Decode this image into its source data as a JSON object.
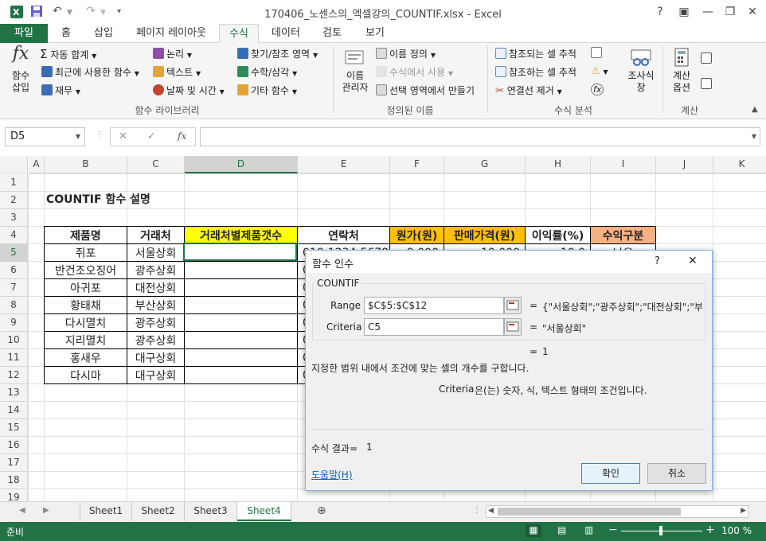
{
  "window": {
    "title": "170406_노센스의_엑셀강의_COUNTIF.xlsx - Excel",
    "help": "?"
  },
  "ribbon_tabs": [
    "파일",
    "홈",
    "삽입",
    "페이지 레이아웃",
    "수식",
    "데이터",
    "검토",
    "보기"
  ],
  "ribbon": {
    "function_library": {
      "insert_function": [
        "함수",
        "삽입"
      ],
      "autosum": "자동 합계",
      "recent": "최근에 사용한 함수",
      "financial": "재무",
      "logical": "논리",
      "text": "텍스트",
      "datetime": "날짜 및 시간",
      "lookup": "찾기/참조 영역",
      "math": "수학/삼각",
      "more": "기타 함수",
      "group_label": "함수 라이브러리"
    },
    "defined_names": {
      "name_manager": [
        "이름",
        "관리자"
      ],
      "define_name": "이름 정의",
      "use_in_formula": "수식에서 사용",
      "create_from_selection": "선택 영역에서 만들기",
      "group_label": "정의된 이름"
    },
    "formula_auditing": {
      "trace_precedents": "참조되는 셀 추적",
      "trace_dependents": "참조하는 셀 추적",
      "remove_arrows": "연결선 제거",
      "watch_window": [
        "조사식",
        "창"
      ],
      "group_label": "수식 분석"
    },
    "calculation": {
      "options": [
        "계산",
        "옵션"
      ],
      "group_label": "계산"
    }
  },
  "formula_bar": {
    "name_box": "D5",
    "cancel": "✕",
    "enter": "✓",
    "fx": "fx",
    "content": ""
  },
  "columns": [
    "A",
    "B",
    "C",
    "D",
    "E",
    "F",
    "G",
    "H",
    "I",
    "J",
    "K"
  ],
  "rows": [
    "1",
    "2",
    "3",
    "4",
    "5",
    "6",
    "7",
    "8",
    "9",
    "10",
    "11",
    "12",
    "13",
    "14",
    "15",
    "16",
    "17",
    "18",
    "19"
  ],
  "sheet": {
    "title": "COUNTIF 함수 설명",
    "headers": [
      "제품명",
      "거래처",
      "거래처별제품갯수",
      "연락처",
      "원가(원)",
      "판매가격(원)",
      "이익률(%)",
      "수익구분"
    ],
    "header_colors": [
      "#ffffff",
      "#ffffff",
      "#ffff00",
      "#ffffff",
      "#ffc000",
      "#ffc000",
      "#ffffff",
      "#f4b183"
    ],
    "rows": [
      [
        "쥐포",
        "서울상회",
        "",
        "010-1234-5678",
        "9,000",
        "10,000",
        "10.0",
        "낮음"
      ],
      [
        "반건조오징어",
        "광주상회",
        "",
        "0",
        "",
        "",
        "",
        ""
      ],
      [
        "아귀포",
        "대전상회",
        "",
        "0",
        "",
        "",
        "",
        ""
      ],
      [
        "황태채",
        "부산상회",
        "",
        "0",
        "",
        "",
        "",
        ""
      ],
      [
        "다시멸치",
        "광주상회",
        "",
        "0",
        "",
        "",
        "",
        ""
      ],
      [
        "지리멸치",
        "광주상회",
        "",
        "0",
        "",
        "",
        "",
        ""
      ],
      [
        "홍새우",
        "대구상회",
        "",
        "0",
        "",
        "",
        "",
        ""
      ],
      [
        "다시마",
        "대구상회",
        "",
        "0",
        "",
        "",
        "",
        ""
      ]
    ]
  },
  "sheet_tabs": [
    "Sheet1",
    "Sheet2",
    "Sheet3",
    "Sheet4"
  ],
  "active_sheet": "Sheet4",
  "status": {
    "mode": "준비",
    "zoom": "100 %"
  },
  "dialog": {
    "title": "함수 인수",
    "help": "?",
    "function_name": "COUNTIF",
    "range_label": "Range",
    "range_value": "$C$5:$C$12",
    "range_result": "{\"서울상회\";\"광주상회\";\"대전상회\";\"부",
    "criteria_label": "Criteria",
    "criteria_value": "C5",
    "criteria_result": "\"서울상회\"",
    "eq": "=",
    "result_value": "1",
    "description": "지정한 범위 내에서 조건에 맞는 셀의 개수를 구합니다.",
    "arg_name": "Criteria",
    "arg_description": "은(는) 숫자, 식, 텍스트 형태의 조건입니다.",
    "formula_result_label": "수식 결과=",
    "formula_result_value": "1",
    "help_link": "도움말(H)",
    "ok": "확인",
    "cancel": "취소"
  },
  "colors": {
    "excel_green": "#217346",
    "selection": "#217346"
  }
}
